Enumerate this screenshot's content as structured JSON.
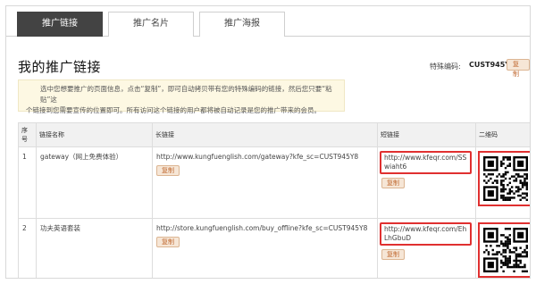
{
  "tabs": [
    {
      "label": "推广链接",
      "active": true
    },
    {
      "label": "推广名片",
      "active": false
    },
    {
      "label": "推广海报",
      "active": false
    }
  ],
  "page": {
    "title": "我的推广链接",
    "code_label": "特殊编码:",
    "code_value": "CUST945Y8",
    "copy_label": "复制"
  },
  "notice": {
    "line1": "选中您想要推广的页面信息，点击“复制”，即可自动拷贝带有您的特殊编码的链接，然后您只要“粘贴”这",
    "line2": "个链接到您需要宣传的位置即可。所有访问这个链接的用户都将被自动记录是您的推广带来的会员。"
  },
  "table": {
    "headers": [
      "序号",
      "链接名称",
      "长链接",
      "短链接",
      "二维码"
    ],
    "rows": [
      {
        "index": "1",
        "name": "gateway（网上免费体验）",
        "long_url": "http://www.kungfuenglish.com/gateway?kfe_sc=CUST945Y8",
        "short_url": "http://www.kfeqr.com/SSwiaht6",
        "copy_label": "复制"
      },
      {
        "index": "2",
        "name": "功夫英语套装",
        "long_url": "http://store.kungfuenglish.com/buy_offline?kfe_sc=CUST945Y8",
        "short_url": "http://www.kfeqr.com/EhLhGbuD",
        "copy_label": "复制"
      }
    ]
  },
  "colors": {
    "tab_active_bg": "#434343",
    "highlight_border": "#e03030",
    "copy_button_bg": "#f6e6d6",
    "copy_button_text": "#c0682f",
    "notice_bg": "#fdf8e3"
  }
}
